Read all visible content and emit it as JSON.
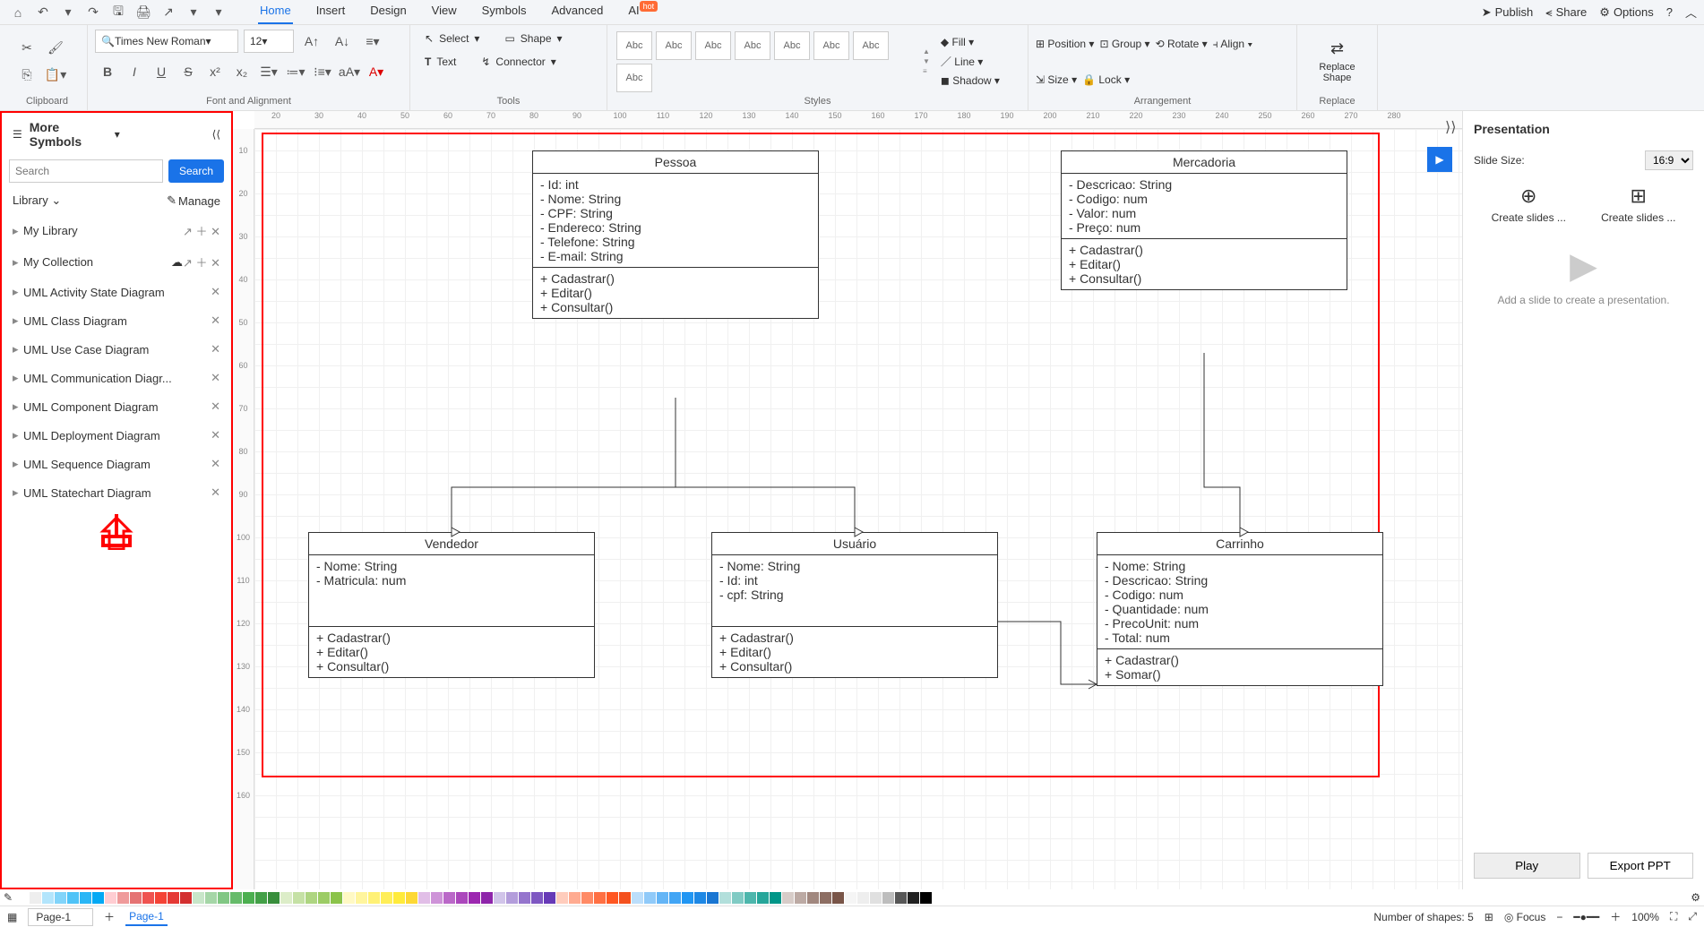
{
  "qat": {
    "home": "⌂",
    "undo": "↶",
    "redo": "↷",
    "save": "🖫",
    "print": "🖨",
    "export": "↗",
    "more": "▾"
  },
  "tabs": [
    "Home",
    "Insert",
    "Design",
    "View",
    "Symbols",
    "Advanced",
    "AI"
  ],
  "active_tab_index": 0,
  "ai_badge": "hot",
  "topright": {
    "publish": "Publish",
    "share": "Share",
    "options": "Options"
  },
  "ribbon": {
    "clipboard": {
      "label": "Clipboard"
    },
    "font": {
      "name": "Times New Roman",
      "size": "12",
      "label": "Font and Alignment"
    },
    "tools": {
      "select": "Select",
      "shape": "Shape",
      "text": "Text",
      "connector": "Connector",
      "label": "Tools"
    },
    "styles": {
      "sample": "Abc",
      "label": "Styles",
      "fill": "Fill",
      "line": "Line",
      "shadow": "Shadow"
    },
    "arrange": {
      "position": "Position",
      "group": "Group",
      "rotate": "Rotate",
      "align": "Align",
      "size": "Size",
      "lock": "Lock",
      "label": "Arrangement"
    },
    "replace": {
      "top": "Replace",
      "bottom": "Shape",
      "label": "Replace"
    }
  },
  "sidebar": {
    "title": "More Symbols",
    "search_ph": "Search",
    "search_btn": "Search",
    "library": "Library",
    "manage": "Manage",
    "items": [
      {
        "name": "My Library",
        "extras": true
      },
      {
        "name": "My Collection",
        "cloud": true,
        "extras": true
      },
      {
        "name": "UML Activity State Diagram"
      },
      {
        "name": "UML Class Diagram"
      },
      {
        "name": "UML Use Case Diagram"
      },
      {
        "name": "UML Communication Diagr..."
      },
      {
        "name": "UML Component Diagram"
      },
      {
        "name": "UML Deployment Diagram"
      },
      {
        "name": "UML Sequence Diagram"
      },
      {
        "name": "UML Statechart Diagram"
      }
    ]
  },
  "ruler_h": [
    "20",
    "30",
    "40",
    "50",
    "60",
    "70",
    "80",
    "90",
    "100",
    "110",
    "120",
    "130",
    "140",
    "150",
    "160",
    "170",
    "180",
    "190",
    "200",
    "210",
    "220",
    "230",
    "240",
    "250",
    "260",
    "270",
    "280"
  ],
  "ruler_v": [
    "10",
    "20",
    "30",
    "40",
    "50",
    "60",
    "70",
    "80",
    "90",
    "100",
    "110",
    "120",
    "130",
    "140",
    "150",
    "160"
  ],
  "classes": {
    "pessoa": {
      "title": "Pessoa",
      "attrs": [
        "- Id: int",
        "- Nome: String",
        "- CPF: String",
        "- Endereco: String",
        "- Telefone: String",
        "- E-mail: String"
      ],
      "ops": [
        "+ Cadastrar()",
        "+ Editar()",
        "+ Consultar()"
      ]
    },
    "mercadoria": {
      "title": "Mercadoria",
      "attrs": [
        "- Descricao: String",
        "- Codigo: num",
        "- Valor: num",
        "- Preço: num"
      ],
      "ops": [
        "+ Cadastrar()",
        "+ Editar()",
        "+ Consultar()"
      ]
    },
    "vendedor": {
      "title": "Vendedor",
      "attrs": [
        "- Nome: String",
        "- Matricula: num"
      ],
      "ops": [
        "+ Cadastrar()",
        "+ Editar()",
        "+ Consultar()"
      ]
    },
    "usuario": {
      "title": "Usuário",
      "attrs": [
        "- Nome: String",
        "- Id: int",
        "- cpf: String"
      ],
      "ops": [
        "+ Cadastrar()",
        "+ Editar()",
        "+ Consultar()"
      ]
    },
    "carrinho": {
      "title": "Carrinho",
      "attrs": [
        "- Nome: String",
        "- Descricao: String",
        "- Codigo: num",
        "- Quantidade: num",
        "- PrecoUnit: num",
        "- Total: num"
      ],
      "ops": [
        "+ Cadastrar()",
        "+ Somar()"
      ]
    }
  },
  "presentation": {
    "title": "Presentation",
    "slide_size": "Slide Size:",
    "ratio": "16:9",
    "create1": "Create slides ...",
    "create2": "Create slides ...",
    "placeholder": "Add a slide to create a presentation.",
    "play": "Play",
    "export": "Export PPT"
  },
  "status": {
    "page_sel": "Page-1",
    "page_tab": "Page-1",
    "shapes": "Number of shapes: 5",
    "focus": "Focus",
    "zoom": "100%"
  },
  "colors": [
    "#ffffff",
    "#eeeeee",
    "#b3e5fc",
    "#81d4fa",
    "#4fc3f7",
    "#29b6f6",
    "#03a9f4",
    "#ffcdd2",
    "#ef9a9a",
    "#e57373",
    "#ef5350",
    "#f44336",
    "#e53935",
    "#d32f2f",
    "#c8e6c9",
    "#a5d6a7",
    "#81c784",
    "#66bb6a",
    "#4caf50",
    "#43a047",
    "#388e3c",
    "#dcedc8",
    "#c5e1a5",
    "#aed581",
    "#9ccc65",
    "#8bc34a",
    "#fff9c4",
    "#fff59d",
    "#fff176",
    "#ffee58",
    "#ffeb3b",
    "#fdd835",
    "#e1bee7",
    "#ce93d8",
    "#ba68c8",
    "#ab47bc",
    "#9c27b0",
    "#8e24aa",
    "#d1c4e9",
    "#b39ddb",
    "#9575cd",
    "#7e57c2",
    "#673ab7",
    "#ffccbc",
    "#ffab91",
    "#ff8a65",
    "#ff7043",
    "#ff5722",
    "#f4511e",
    "#bbdefb",
    "#90caf9",
    "#64b5f6",
    "#42a5f5",
    "#2196f3",
    "#1e88e5",
    "#1976d2",
    "#b2dfdb",
    "#80cbc4",
    "#4db6ac",
    "#26a69a",
    "#009688",
    "#d7ccc8",
    "#bcaaa4",
    "#a1887f",
    "#8d6e63",
    "#795548",
    "#f5f5f5",
    "#eeeeee",
    "#e0e0e0",
    "#bdbdbd",
    "#575757",
    "#212121",
    "#000000"
  ]
}
